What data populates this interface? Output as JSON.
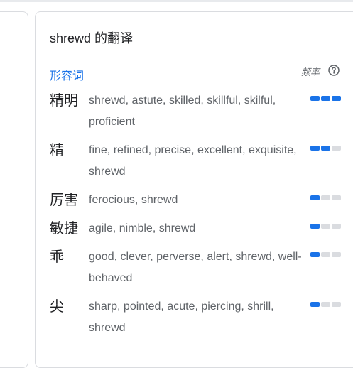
{
  "header": {
    "title": "shrewd 的翻译"
  },
  "pos_label": "形容词",
  "frequency_label": "频率",
  "icons": {
    "help": "help-circle-icon"
  },
  "colors": {
    "accent": "#1a73e8",
    "inactive": "#dadce0"
  },
  "entries": [
    {
      "word": "精明",
      "translations": "shrewd, astute, skilled, skillful, skilful, proficient",
      "frequency": 3
    },
    {
      "word": "精",
      "translations": "fine, refined, precise, excellent, exquisite, shrewd",
      "frequency": 2
    },
    {
      "word": "厉害",
      "translations": "ferocious, shrewd",
      "frequency": 1
    },
    {
      "word": "敏捷",
      "translations": "agile, nimble, shrewd",
      "frequency": 1
    },
    {
      "word": "乖",
      "translations": "good, clever, perverse, alert, shrewd, well-behaved",
      "frequency": 1
    },
    {
      "word": "尖",
      "translations": "sharp, pointed, acute, piercing, shrill, shrewd",
      "frequency": 1
    }
  ]
}
